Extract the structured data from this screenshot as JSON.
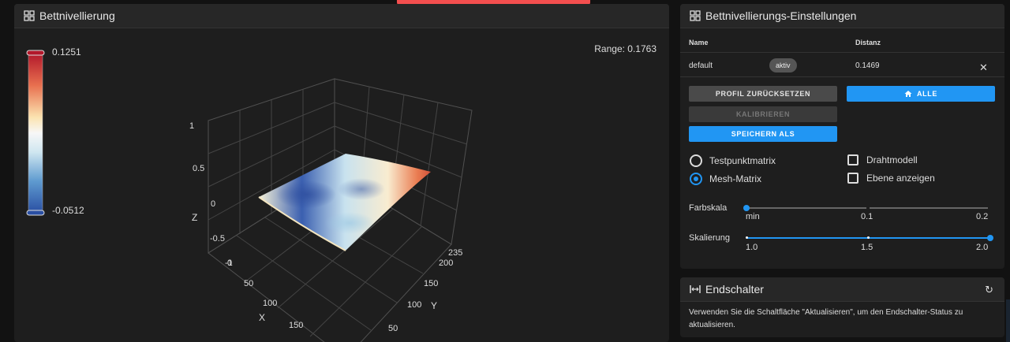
{
  "mesh_panel": {
    "title": "Bettnivellierung",
    "range_label": "Range: 0.1763",
    "colorbar": {
      "max": "0.1251",
      "min": "-0.0512",
      "colors": [
        "#b2182b",
        "#ef8a62",
        "#fddbc7",
        "#f7f7f7",
        "#d1e5f0",
        "#67a9cf",
        "#2166ac"
      ]
    },
    "z_ticks": [
      "1",
      "0.5",
      "0",
      "-0.5",
      "-1"
    ],
    "z_label": "Z",
    "x_ticks": [
      "0",
      "50",
      "100",
      "150"
    ],
    "x_label": "X",
    "y_ticks": [
      "50",
      "100",
      "150",
      "200",
      "235"
    ],
    "y_label": "Y"
  },
  "settings": {
    "title": "Bettnivellierungs-Einstellungen",
    "col_name": "Name",
    "col_distance": "Distanz",
    "profile": {
      "name": "default",
      "badge": "aktiv",
      "distance": "0.1469"
    },
    "buttons": {
      "reset_profile": "PROFIL ZURÜCKSETZEN",
      "home_all": "ALLE",
      "calibrate": "KALIBRIEREN",
      "save_as": "SPEICHERN ALS"
    },
    "options": {
      "probe_matrix": "Testpunktmatrix",
      "mesh_matrix": "Mesh-Matrix",
      "wireframe": "Drahtmodell",
      "show_plane": "Ebene anzeigen"
    },
    "color_scale": {
      "label": "Farbskala",
      "ticks": [
        "min",
        "0.1",
        "0.2"
      ],
      "value": "min"
    },
    "scaling": {
      "label": "Skalierung",
      "ticks": [
        "1.0",
        "1.5",
        "2.0"
      ],
      "value": 2.0
    }
  },
  "endstops": {
    "title": "Endschalter",
    "text": "Verwenden Sie die Schaltfläche \"Aktualisieren\", um den Endschalter-Status zu aktualisieren."
  },
  "accent_color": "#2196f3"
}
